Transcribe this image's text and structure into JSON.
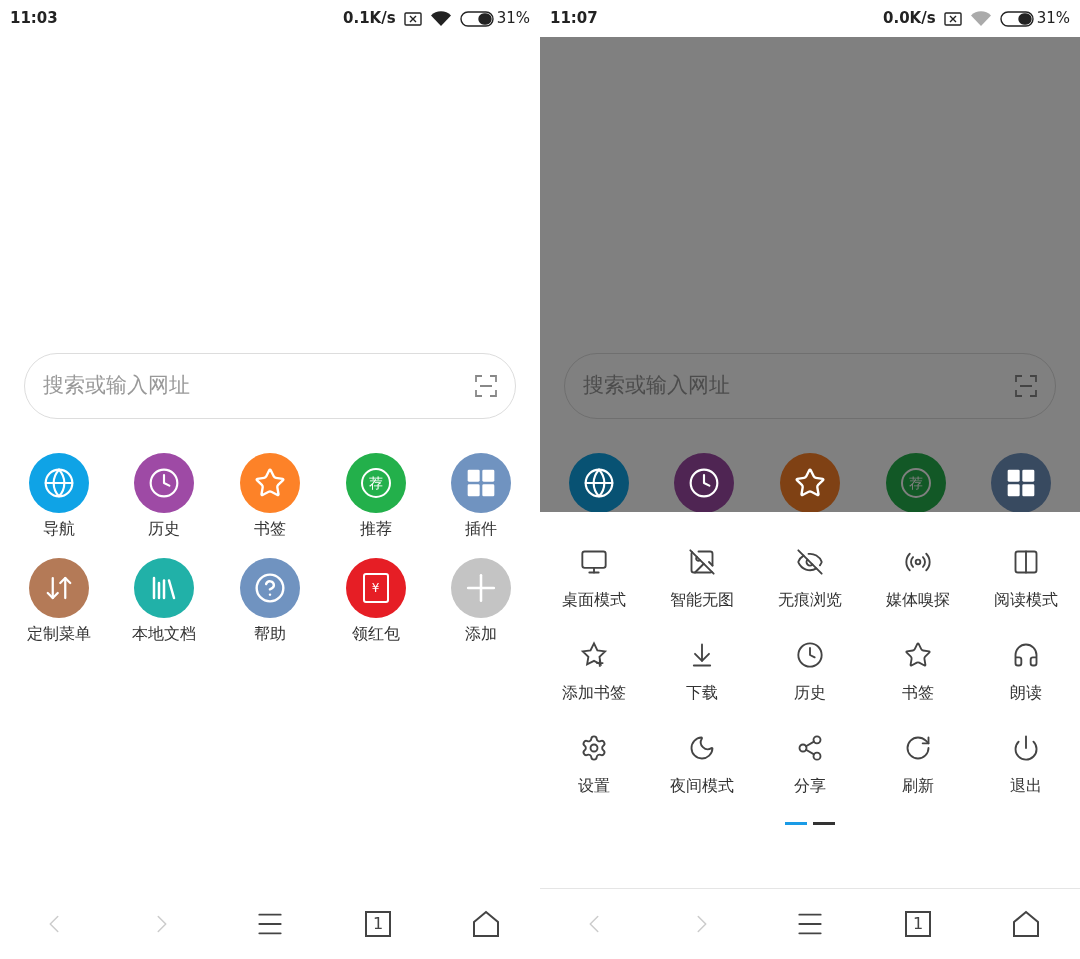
{
  "screens": [
    {
      "status_bar": {
        "time": "11:03",
        "speed": "0.1K/s",
        "battery": "31%",
        "wifi_dim": false
      },
      "search": {
        "placeholder": "搜索或输入网址"
      },
      "shortcuts": [
        {
          "label": "导航",
          "color": "#0fa3e6"
        },
        {
          "label": "历史",
          "color": "#9e4aa5"
        },
        {
          "label": "书签",
          "color": "#fd8228"
        },
        {
          "label": "推荐",
          "color": "#23b04b",
          "glyph": "荐"
        },
        {
          "label": "插件",
          "color": "#7093c0"
        },
        {
          "label": "定制菜单",
          "color": "#b47a57"
        },
        {
          "label": "本地文档",
          "color": "#21b1a8"
        },
        {
          "label": "帮助",
          "color": "#7093c0"
        },
        {
          "label": "领红包",
          "color": "#e61e25",
          "glyph": "¥"
        },
        {
          "label": "添加",
          "color": "#c4c4c4"
        }
      ],
      "nav": {
        "back_disabled": true,
        "forward_disabled": true,
        "tab_count": "1"
      }
    },
    {
      "status_bar": {
        "time": "11:07",
        "speed": "0.0K/s",
        "battery": "31%",
        "wifi_dim": true
      },
      "search": {
        "placeholder": "搜索或输入网址"
      },
      "shortcuts": [
        {
          "color": "#085273"
        },
        {
          "color": "#4f2553"
        },
        {
          "color": "#7f4114"
        },
        {
          "color": "#125826",
          "glyph": "荐"
        },
        {
          "color": "#384a60"
        }
      ],
      "menu": {
        "items": [
          {
            "label": "桌面模式"
          },
          {
            "label": "智能无图"
          },
          {
            "label": "无痕浏览"
          },
          {
            "label": "媒体嗅探"
          },
          {
            "label": "阅读模式"
          },
          {
            "label": "添加书签"
          },
          {
            "label": "下载"
          },
          {
            "label": "历史"
          },
          {
            "label": "书签"
          },
          {
            "label": "朗读"
          },
          {
            "label": "设置"
          },
          {
            "label": "夜间模式"
          },
          {
            "label": "分享"
          },
          {
            "label": "刷新"
          },
          {
            "label": "退出"
          }
        ],
        "pages": [
          {
            "selected": true
          },
          {
            "selected": false
          }
        ]
      },
      "nav": {
        "back_disabled": true,
        "forward_disabled": true,
        "tab_count": "1"
      }
    }
  ]
}
